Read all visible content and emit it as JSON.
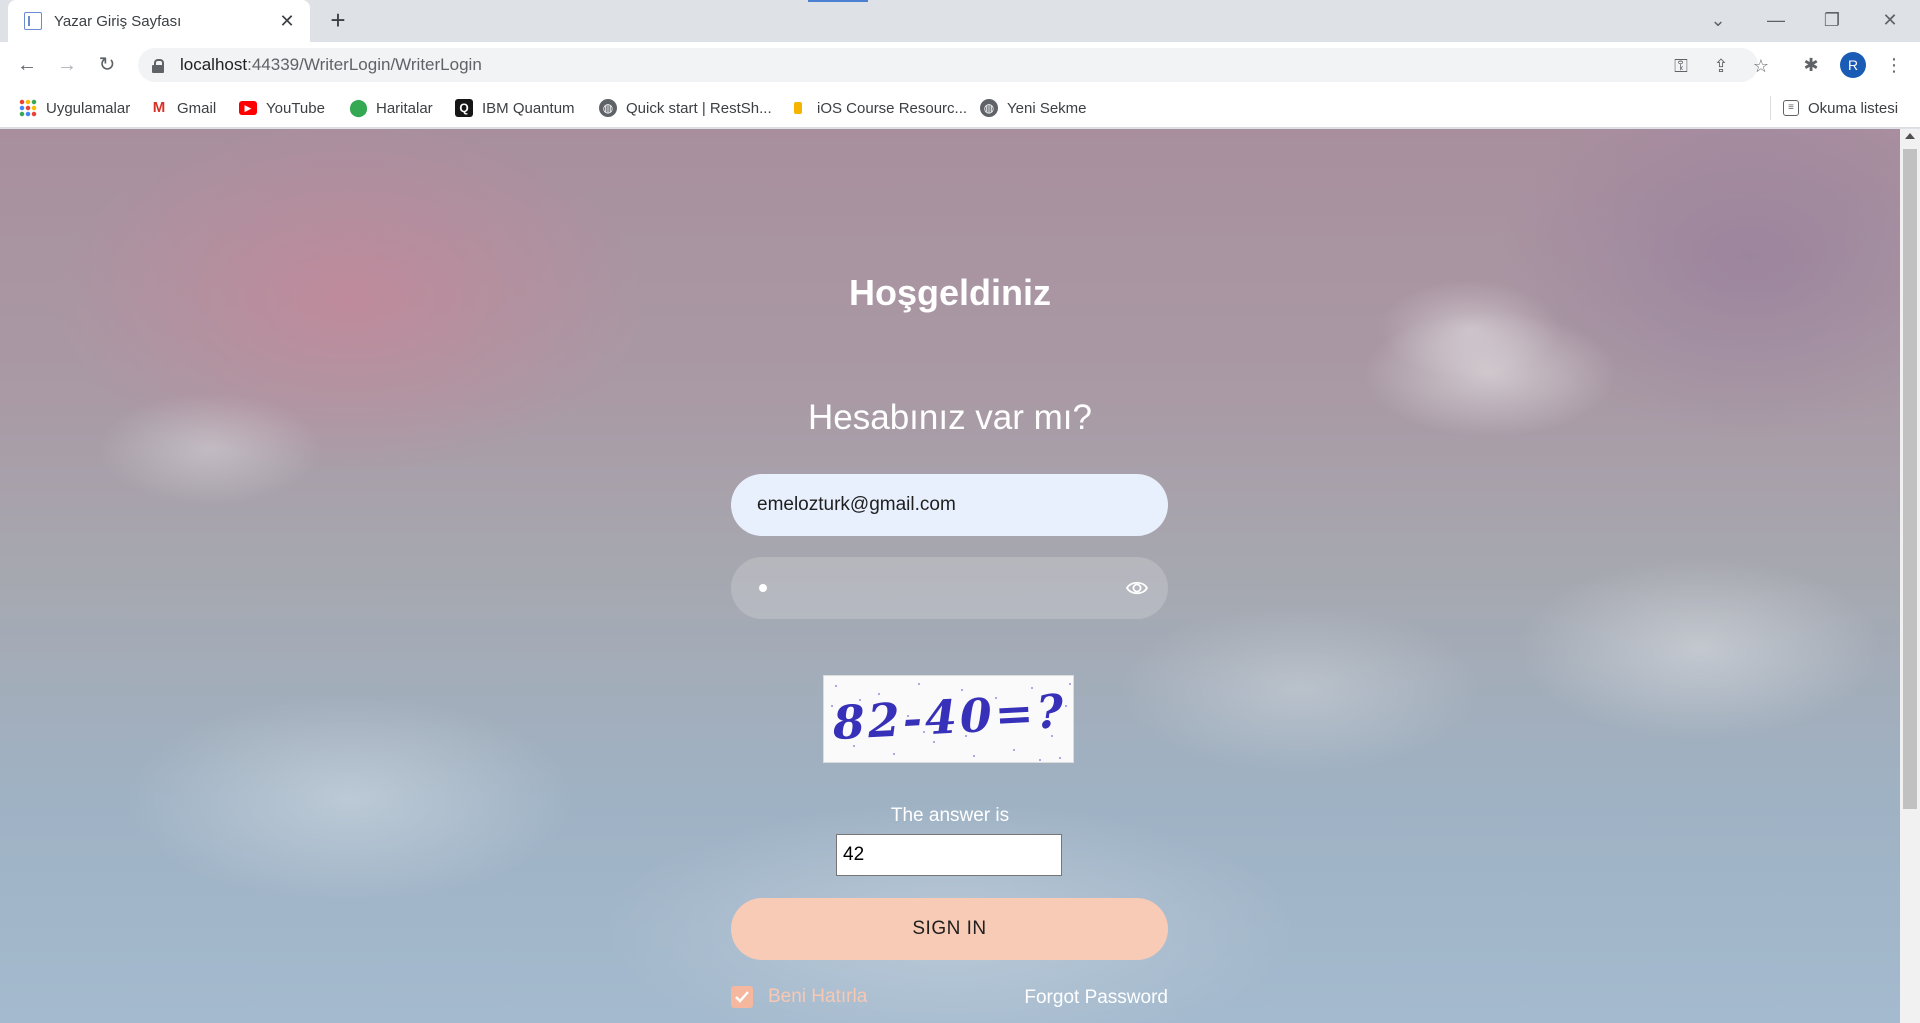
{
  "browser": {
    "tab_title": "Yazar Giriş Sayfası",
    "tab_close": "✕",
    "new_tab": "+",
    "url_host": "localhost",
    "url_rest": ":44339/WriterLogin/WriterLogin",
    "avatar_letter": "R",
    "icons": [
      "back-icon",
      "forward-icon",
      "reload-icon",
      "lock-icon",
      "key-icon",
      "share-icon",
      "star-icon",
      "extensions-icon",
      "menu-icon"
    ]
  },
  "bookmarks": [
    {
      "label": "Uygulamalar",
      "icon": "apps-grid-icon"
    },
    {
      "label": "Gmail",
      "icon": "gmail-icon"
    },
    {
      "label": "YouTube",
      "icon": "youtube-icon"
    },
    {
      "label": "Haritalar",
      "icon": "maps-icon"
    },
    {
      "label": "IBM Quantum",
      "icon": "ibm-quantum-icon"
    },
    {
      "label": "Quick start | RestSh...",
      "icon": "globe-icon"
    },
    {
      "label": "iOS Course Resourc...",
      "icon": "ios-course-icon"
    },
    {
      "label": "Yeni Sekme",
      "icon": "globe-icon"
    }
  ],
  "reading_list": "Okuma listesi",
  "login": {
    "welcome": "Hoşgeldiniz",
    "question": "Hesabınız var mı?",
    "email_value": "emelozturk@gmail.com",
    "captcha_text": "82-40=?",
    "answer_label": "The answer is",
    "answer_value": "42",
    "signin_label": "SIGN IN",
    "remember_label": "Beni Hatırla",
    "remember_checked": true,
    "forgot_label": "Forgot Password"
  },
  "colors": {
    "signin_bg": "#f8cbb6",
    "email_bg": "#e8f0fe",
    "remember_text": "#f8c8b3"
  }
}
